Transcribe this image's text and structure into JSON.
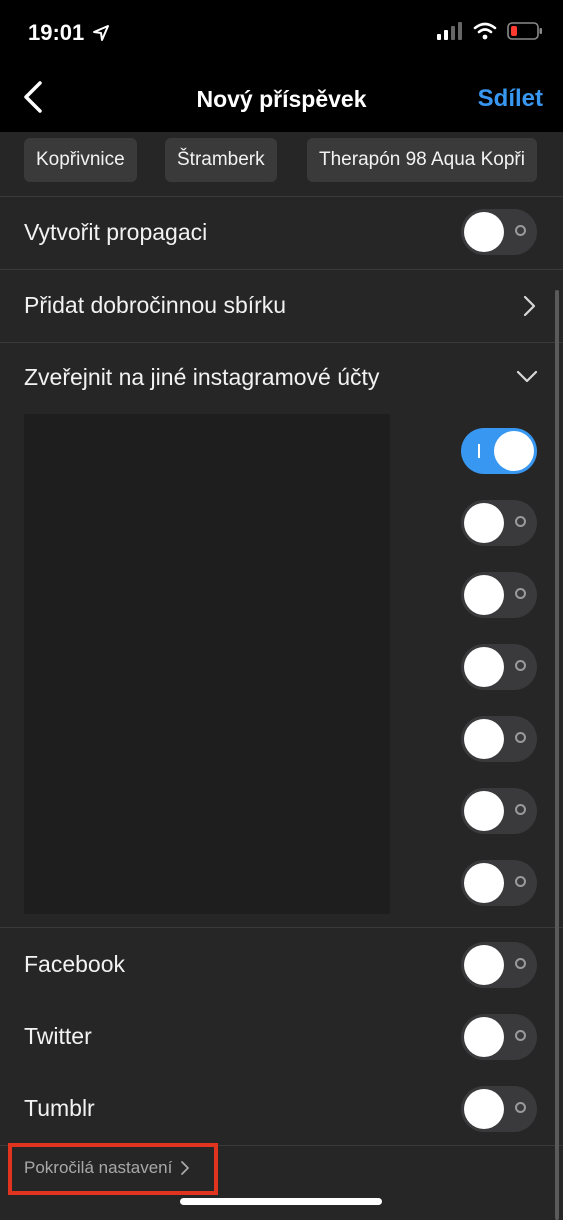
{
  "status_bar": {
    "time": "19:01"
  },
  "nav": {
    "title": "Nový příspěvek",
    "share_label": "Sdílet"
  },
  "location_chips": [
    "Kopřivnice",
    "Štramberk",
    "Therapón 98 Aqua Kopři"
  ],
  "settings": {
    "promotion_label": "Vytvořit propagaci",
    "fundraiser_label": "Přidat dobročinnou sbírku",
    "share_accounts_label": "Zveřejnit na jiné instagramové účty"
  },
  "account_toggles": [
    true,
    false,
    false,
    false,
    false,
    false,
    false
  ],
  "share_targets": [
    {
      "label": "Facebook",
      "on": false
    },
    {
      "label": "Twitter",
      "on": false
    },
    {
      "label": "Tumblr",
      "on": false
    }
  ],
  "advanced_label": "Pokročilá nastavení",
  "colors": {
    "accent": "#3897f0",
    "background": "#262626",
    "highlight": "#e0341f"
  }
}
